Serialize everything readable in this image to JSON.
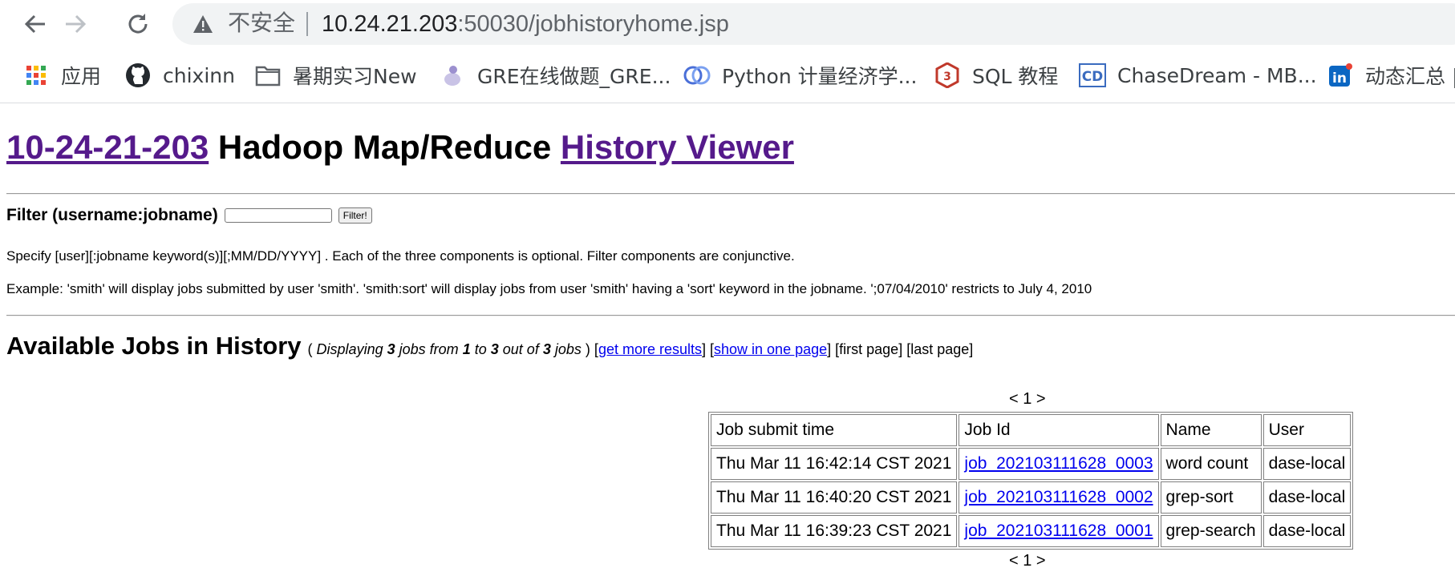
{
  "browser": {
    "insecure_label": "不安全",
    "url_host": "10.24.21.203",
    "url_rest": ":50030/jobhistoryhome.jsp",
    "bookmarks": [
      {
        "label": "应用",
        "icon": "apps-grid-icon"
      },
      {
        "label": "chixinn",
        "icon": "github-icon"
      },
      {
        "label": "暑期实习New",
        "icon": "folder-icon"
      },
      {
        "label": "GRE在线做题_GRE...",
        "icon": "gre-site-icon"
      },
      {
        "label": "Python 计量经济学...",
        "icon": "python-site-icon"
      },
      {
        "label": "SQL 教程",
        "icon": "runoob-icon"
      },
      {
        "label": "ChaseDream - MB...",
        "icon": "chasedream-icon"
      },
      {
        "label": "动态汇总 |",
        "icon": "linkedin-icon"
      }
    ]
  },
  "header": {
    "host_link": "10-24-21-203",
    "middle": "Hadoop Map/Reduce",
    "viewer_link": "History Viewer"
  },
  "filter": {
    "label": "Filter (username:jobname)",
    "input_value": "",
    "button_label": "Filter!"
  },
  "help": {
    "spec": "Specify [user][:jobname keyword(s)][;MM/DD/YYYY] . Each of the three components is optional. Filter components are conjunctive.",
    "example": "Example: 'smith' will display jobs submitted by user 'smith'. 'smith:sort' will display jobs from user 'smith' having a 'sort' keyword in the jobname. ';07/04/2010' restricts to July 4, 2010"
  },
  "available": {
    "heading": "Available Jobs in History",
    "open_paren": "(",
    "displaying_prefix": "Displaying",
    "count": "3",
    "jobs_from": "jobs from",
    "start": "1",
    "to": "to",
    "end": "3",
    "out_of": "out of",
    "total": "3",
    "jobs_word": "jobs",
    "close_paren": ")",
    "more_results": "get more results",
    "show_one_page": "show in one page",
    "first_page": "first page",
    "last_page": "last page"
  },
  "pager": {
    "text": "< 1 >"
  },
  "table": {
    "headers": [
      "Job submit time",
      "Job Id",
      "Name",
      "User"
    ],
    "rows": [
      {
        "time": "Thu Mar 11 16:42:14 CST 2021",
        "job_id": "job_202103111628_0003",
        "name": "word count",
        "user": "dase-local"
      },
      {
        "time": "Thu Mar 11 16:40:20 CST 2021",
        "job_id": "job_202103111628_0002",
        "name": "grep-sort",
        "user": "dase-local"
      },
      {
        "time": "Thu Mar 11 16:39:23 CST 2021",
        "job_id": "job_202103111628_0001",
        "name": "grep-search",
        "user": "dase-local"
      }
    ]
  }
}
